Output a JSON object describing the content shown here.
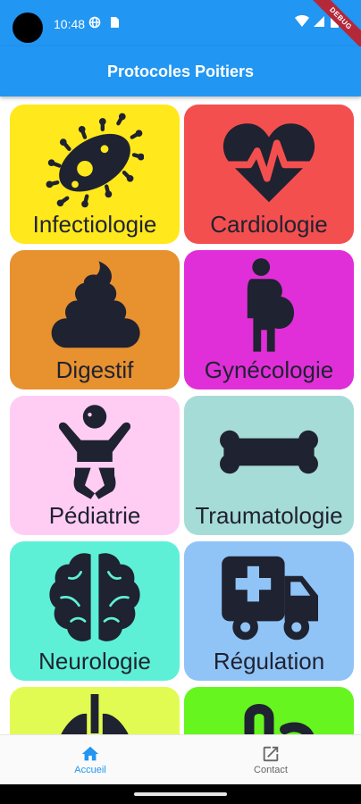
{
  "status_bar": {
    "time": "10:48",
    "debug_label": "DEBUG"
  },
  "app_bar": {
    "title": "Protocoles Poitiers"
  },
  "tiles": [
    {
      "label": "Infectiologie",
      "color": "#ffe81c",
      "icon": "bacteria-icon"
    },
    {
      "label": "Cardiologie",
      "color": "#f44f4f",
      "icon": "heart-pulse-icon"
    },
    {
      "label": "Digestif",
      "color": "#e8912f",
      "icon": "poop-icon"
    },
    {
      "label": "Gynécologie",
      "color": "#e02fd8",
      "icon": "pregnant-woman-icon"
    },
    {
      "label": "Pédiatrie",
      "color": "#ffcdf4",
      "icon": "baby-icon"
    },
    {
      "label": "Traumatologie",
      "color": "#a6dcd8",
      "icon": "bone-icon"
    },
    {
      "label": "Neurologie",
      "color": "#5ef0d6",
      "icon": "brain-icon"
    },
    {
      "label": "Régulation",
      "color": "#90c4f7",
      "icon": "ambulance-icon"
    },
    {
      "label": "",
      "color": "#e2fb52",
      "icon": "lungs-icon"
    },
    {
      "label": "",
      "color": "#66f51f",
      "icon": "pills-icon"
    }
  ],
  "bottom_nav": {
    "items": [
      {
        "label": "Accueil",
        "icon": "home-icon",
        "active": true
      },
      {
        "label": "Contact",
        "icon": "open-in-new-icon",
        "active": false
      }
    ]
  },
  "colors": {
    "primary": "#2196f3",
    "icon_dark": "#1f2230"
  }
}
